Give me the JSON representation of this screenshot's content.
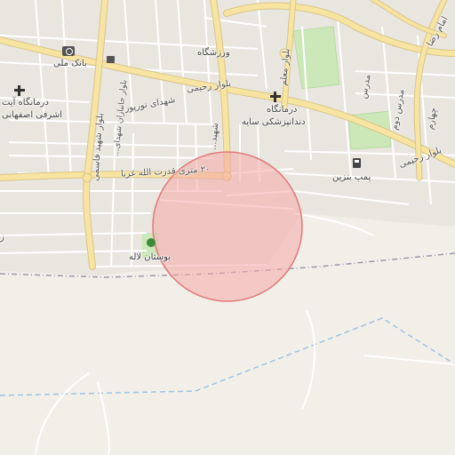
{
  "map": {
    "labels": {
      "bank_meli": "بانک ملی",
      "varzeshgah": "ورزشگاه",
      "blvd_rahimi_1": "بلوار رحیمی",
      "blvd_rahimi_2": "بلوار رحیمی",
      "shohada_noorpoor": "شهدای نورپور",
      "blvd_moallem": "بلوار معلم",
      "clinic_ayat": "درمانگاه آیت",
      "ashrafi_esfahani": "اشرفی اصفهانی",
      "clinic": "درمانگاه",
      "dental_saye": "دندانپزشکی سایه",
      "shahid_qasemi": "بلوار شهید قاسمی",
      "street_20m": "۲۰ متری قدرت الله غربا",
      "street_shahid_north": "شهید...",
      "fuel_pump": "پمپ بنزین",
      "bustan_laleh": "بوستان لاله",
      "blvd_shohada": "بلوار جانبازان شهدای...",
      "street_right_1": "مدرس دوم",
      "street_right_2": "مدرس",
      "street_right_3": "چهارم",
      "imam_reza": "امام رضا",
      "left_edge": "ز"
    },
    "icons": {
      "bank": "atm-bank-icon",
      "shop": "shopping-bag-icon",
      "clinic1": "medical-cross-icon",
      "clinic2": "medical-cross-icon",
      "fuel": "fuel-station-icon",
      "park": "tree-park-icon"
    },
    "colors": {
      "background": "#f2efe9",
      "highway": "#f7e4a0",
      "park": "#cce8b8",
      "circle_fill": "#f4a7a7",
      "circle_stroke": "#e07a7a"
    }
  }
}
